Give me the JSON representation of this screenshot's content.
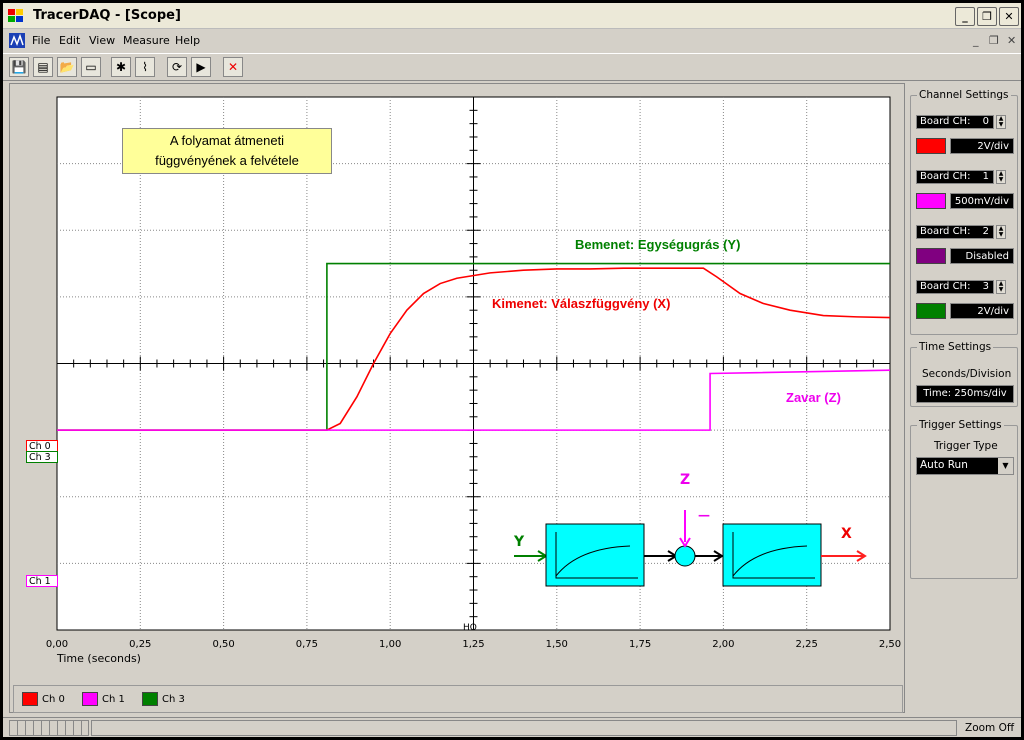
{
  "window": {
    "title": "TracerDAQ - [Scope]"
  },
  "menu": [
    "File",
    "Edit",
    "View",
    "Measure",
    "Help"
  ],
  "channel_settings": {
    "title": "Channel Settings",
    "channels": [
      {
        "label": "Board CH:",
        "num": "0",
        "color": "#ff0000",
        "scale": "2V/div"
      },
      {
        "label": "Board CH:",
        "num": "1",
        "color": "#ff00ff",
        "scale": "500mV/div"
      },
      {
        "label": "Board CH:",
        "num": "2",
        "color": "#800080",
        "scale": "Disabled"
      },
      {
        "label": "Board CH:",
        "num": "3",
        "color": "#008000",
        "scale": "2V/div"
      }
    ]
  },
  "time_settings": {
    "title": "Time Settings",
    "subtitle": "Seconds/Division",
    "value": "Time: 250ms/div"
  },
  "trigger_settings": {
    "title": "Trigger Settings",
    "type_label": "Trigger Type",
    "value": "Auto Run"
  },
  "status": {
    "zoom": "Zoom Off"
  },
  "legend": [
    {
      "name": "Ch 0",
      "color": "#ff0000"
    },
    {
      "name": "Ch 1",
      "color": "#ff00ff"
    },
    {
      "name": "Ch 3",
      "color": "#008000"
    }
  ],
  "plot_labels": {
    "ch0": "Ch 0",
    "ch3": "Ch 3",
    "ch1": "Ch 1",
    "trigger_marker": "HO",
    "annotation": [
      "A folyamat átmeneti",
      "függvényének a felvétele"
    ],
    "input_label": "Bemenet: Egységugrás (Y)",
    "output_label": "Kimenet: Válaszfüggvény (X)",
    "disturbance_label": "Zavar (Z)",
    "diagram_y": "Y",
    "diagram_z": "Z",
    "diagram_x": "X",
    "diagram_minus": "—"
  },
  "chart_data": {
    "type": "line",
    "xlabel": "Time (seconds)",
    "xlim": [
      0,
      2.5
    ],
    "x_ticks": [
      "0,00",
      "0,25",
      "0,50",
      "0,75",
      "1,00",
      "1,25",
      "1,50",
      "1,75",
      "2,00",
      "2,25",
      "2,50"
    ],
    "ylim": [
      -4,
      4
    ],
    "series": [
      {
        "name": "Ch 3",
        "color": "#008000",
        "x": [
          0,
          0.81,
          0.81,
          2.5
        ],
        "y": [
          -1,
          -1,
          1.5,
          1.5
        ]
      },
      {
        "name": "Ch 0",
        "color": "#ff0000",
        "x": [
          0,
          0.81,
          0.85,
          0.9,
          0.95,
          1.0,
          1.05,
          1.1,
          1.15,
          1.2,
          1.3,
          1.4,
          1.5,
          1.6,
          1.7,
          1.8,
          1.94,
          1.98,
          2.05,
          2.12,
          2.2,
          2.3,
          2.4,
          2.5
        ],
        "y": [
          -1,
          -1,
          -0.9,
          -0.5,
          0,
          0.45,
          0.8,
          1.05,
          1.2,
          1.28,
          1.36,
          1.4,
          1.42,
          1.42,
          1.43,
          1.43,
          1.43,
          1.3,
          1.05,
          0.9,
          0.8,
          0.72,
          0.7,
          0.69
        ]
      },
      {
        "name": "Ch 1",
        "color": "#ff00ff",
        "x": [
          0,
          1.96,
          1.96,
          2.5
        ],
        "y": [
          -1,
          -1,
          -0.15,
          -0.1
        ]
      }
    ]
  }
}
